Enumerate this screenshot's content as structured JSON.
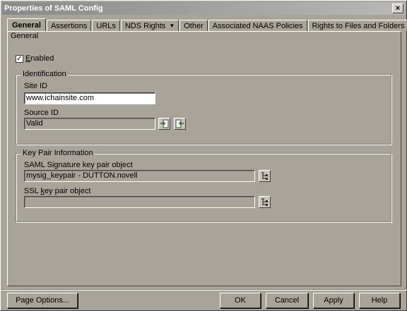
{
  "window": {
    "title": "Properties of SAML Config",
    "close_glyph": "×"
  },
  "tabs": [
    {
      "label": "General",
      "active": true
    },
    {
      "label": "Assertions"
    },
    {
      "label": "URLs"
    },
    {
      "label": "NDS Rights",
      "has_dropdown": true
    },
    {
      "label": "Other"
    },
    {
      "label": "Associated NAAS Policies"
    },
    {
      "label": "Rights to Files and Folders"
    }
  ],
  "subtab": "General",
  "enabled": {
    "label": "Enabled",
    "checked": true,
    "check_glyph": "✓"
  },
  "identification": {
    "title": "Identification",
    "site_id_label": "Site ID",
    "site_id_value": "www.ichainsite.com",
    "source_id_label": "Source ID",
    "source_id_value": "Valid"
  },
  "key_pair": {
    "title": "Key Pair Information",
    "saml_label": "SAML Signature key pair object",
    "saml_value": "mysig_keypair - DUTTON.novell",
    "ssl_label": "SSL key pair object",
    "ssl_value": ""
  },
  "buttons": {
    "page_options": "Page Options...",
    "ok": "OK",
    "cancel": "Cancel",
    "apply": "Apply",
    "help": "Help"
  }
}
